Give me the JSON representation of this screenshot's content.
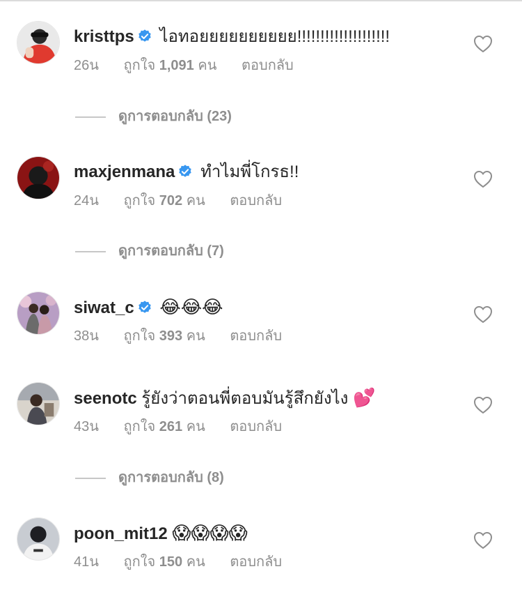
{
  "comments": [
    {
      "username": "kristtps",
      "verified": true,
      "text": "ไอทอยยยยยยยยยย!!!!!!!!!!!!!!!!!!!!",
      "time": "26น",
      "likes_label": "ถูกใจ",
      "likes_count": "1,091",
      "likes_unit": "คน",
      "reply_label": "ตอบกลับ",
      "replies_label": "ดูการตอบกลับ (23)"
    },
    {
      "username": "maxjenmana",
      "verified": true,
      "text": "ทำไมพี่โกรธ!!",
      "time": "24น",
      "likes_label": "ถูกใจ",
      "likes_count": "702",
      "likes_unit": "คน",
      "reply_label": "ตอบกลับ",
      "replies_label": "ดูการตอบกลับ (7)"
    },
    {
      "username": "siwat_c",
      "verified": true,
      "text": "😂😂😂",
      "time": "38น",
      "likes_label": "ถูกใจ",
      "likes_count": "393",
      "likes_unit": "คน",
      "reply_label": "ตอบกลับ"
    },
    {
      "username": "seenotc",
      "verified": false,
      "text": "รู้ยังว่าตอนพี่ตอบมันรู้สึกยังไง",
      "emoji": "💕",
      "time": "43น",
      "likes_label": "ถูกใจ",
      "likes_count": "261",
      "likes_unit": "คน",
      "reply_label": "ตอบกลับ",
      "replies_label": "ดูการตอบกลับ (8)"
    },
    {
      "username": "poon_mit12",
      "verified": false,
      "text": "😱😱😱😱",
      "time": "41น",
      "likes_label": "ถูกใจ",
      "likes_count": "150",
      "likes_unit": "คน",
      "reply_label": "ตอบกลับ"
    }
  ],
  "icons": {
    "verified": "verified-badge-icon",
    "like": "heart-outline-icon"
  },
  "colors": {
    "verified_blue": "#3897f0",
    "meta_gray": "#8e8e8e",
    "text": "#262626"
  }
}
